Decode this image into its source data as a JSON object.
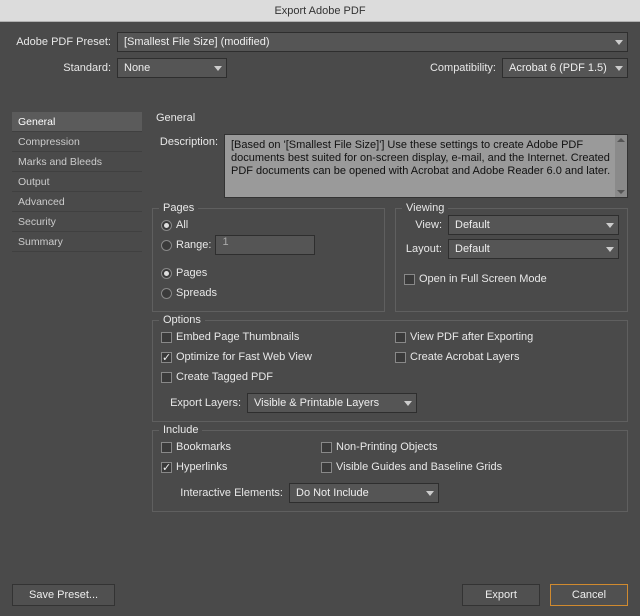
{
  "title": "Export Adobe PDF",
  "presetLabel": "Adobe PDF Preset:",
  "presetValue": "[Smallest File Size] (modified)",
  "standardLabel": "Standard:",
  "standardValue": "None",
  "compatLabel": "Compatibility:",
  "compatValue": "Acrobat 6 (PDF 1.5)",
  "sidebar": {
    "items": [
      {
        "label": "General"
      },
      {
        "label": "Compression"
      },
      {
        "label": "Marks and Bleeds"
      },
      {
        "label": "Output"
      },
      {
        "label": "Advanced"
      },
      {
        "label": "Security"
      },
      {
        "label": "Summary"
      }
    ]
  },
  "panelTitle": "General",
  "descriptionLabel": "Description:",
  "descriptionText": "[Based on '[Smallest File Size]'] Use these settings to create Adobe PDF documents best suited for on-screen display, e-mail, and the Internet. Created PDF documents can be opened with Acrobat and Adobe Reader 6.0 and later.",
  "pages": {
    "legend": "Pages",
    "all": "All",
    "range": "Range:",
    "rangeValue": "1",
    "pages": "Pages",
    "spreads": "Spreads"
  },
  "viewing": {
    "legend": "Viewing",
    "viewLabel": "View:",
    "viewValue": "Default",
    "layoutLabel": "Layout:",
    "layoutValue": "Default",
    "fullscreen": "Open in Full Screen Mode"
  },
  "options": {
    "legend": "Options",
    "embed": "Embed Page Thumbnails",
    "optimize": "Optimize for Fast Web View",
    "tagged": "Create Tagged PDF",
    "viewAfter": "View PDF after Exporting",
    "acrobatLayers": "Create Acrobat Layers",
    "exportLayersLabel": "Export Layers:",
    "exportLayersValue": "Visible & Printable Layers"
  },
  "include": {
    "legend": "Include",
    "bookmarks": "Bookmarks",
    "hyperlinks": "Hyperlinks",
    "nonprint": "Non-Printing Objects",
    "guides": "Visible Guides and Baseline Grids",
    "interactiveLabel": "Interactive Elements:",
    "interactiveValue": "Do Not Include"
  },
  "buttons": {
    "savePreset": "Save Preset...",
    "export": "Export",
    "cancel": "Cancel"
  }
}
